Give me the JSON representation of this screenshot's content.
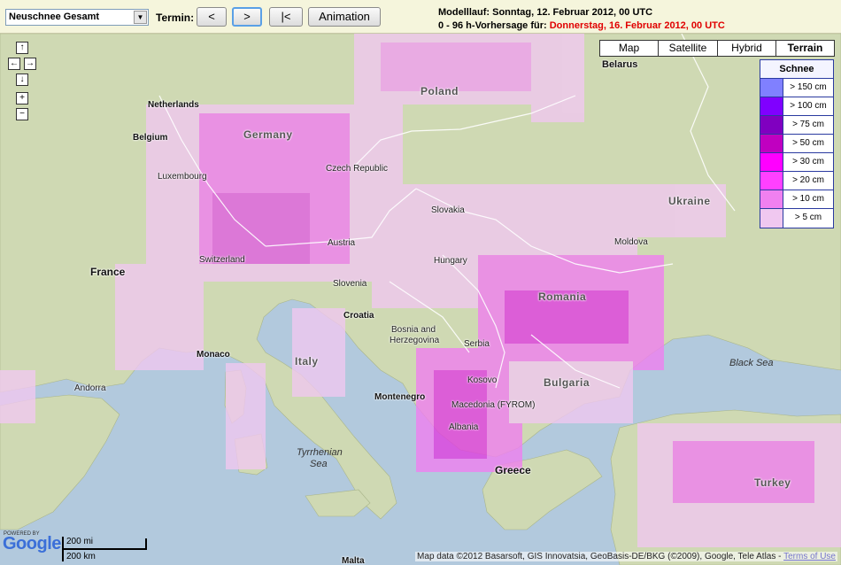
{
  "toolbar": {
    "select_value": "Neuschnee Gesamt",
    "termin_label": "Termin:",
    "btn_prev": "<",
    "btn_next": ">",
    "btn_first": "|<",
    "btn_animation": "Animation",
    "run_line": "Modelllauf: Sonntag, 12. Februar 2012, 00 UTC",
    "forecast_prefix": "0 - 96 h-Vorhersage für:",
    "forecast_date": "Donnerstag, 16. Februar 2012, 00 UTC"
  },
  "map": {
    "map_types": [
      {
        "label": "Map",
        "selected": false
      },
      {
        "label": "Satellite",
        "selected": false
      },
      {
        "label": "Hybrid",
        "selected": false
      },
      {
        "label": "Terrain",
        "selected": true
      }
    ],
    "nav": {
      "up": "↑",
      "left": "←",
      "right": "→",
      "down": "↓",
      "zoom_in": "+",
      "zoom_out": "−"
    },
    "countries": [
      "Poland",
      "Belarus",
      "Germany",
      "Netherlands",
      "Belgium",
      "Luxembourg",
      "Czech Republic",
      "Slovakia",
      "Ukraine",
      "France",
      "Austria",
      "Switzerland",
      "Hungary",
      "Moldova",
      "Romania",
      "Slovenia",
      "Croatia",
      "Bosnia and",
      "Herzegovina",
      "Serbia",
      "Italy",
      "Kosovo",
      "Bulgaria",
      "Macedonia (FYROM)",
      "Albania",
      "Greece",
      "Turkey"
    ],
    "cities": [
      "Monaco",
      "Andorra",
      "Montenegro",
      "Malta"
    ],
    "seas": [
      "Black Sea",
      "Tyrrhenian",
      "Sea"
    ]
  },
  "legend": {
    "title": "Schnee",
    "items": [
      {
        "label": "> 150 cm",
        "color": "#8080ff"
      },
      {
        "label": "> 100 cm",
        "color": "#8000ff"
      },
      {
        "label": "> 75 cm",
        "color": "#8000c0"
      },
      {
        "label": "> 50 cm",
        "color": "#c000c0"
      },
      {
        "label": "> 30 cm",
        "color": "#ff00ff"
      },
      {
        "label": "> 20 cm",
        "color": "#ff40ff"
      },
      {
        "label": "> 10 cm",
        "color": "#f080f0"
      },
      {
        "label": "> 5 cm",
        "color": "#f0c8f0"
      }
    ]
  },
  "footer": {
    "powered": "POWERED BY",
    "google": "Google",
    "scale_mi": "200 mi",
    "scale_km": "200 km",
    "attribution": "Map data ©2012 Basarsoft, GIS Innovatsia, GeoBasis-DE/BKG (©2009), Google, Tele Atlas -",
    "terms": "Terms of Use"
  }
}
